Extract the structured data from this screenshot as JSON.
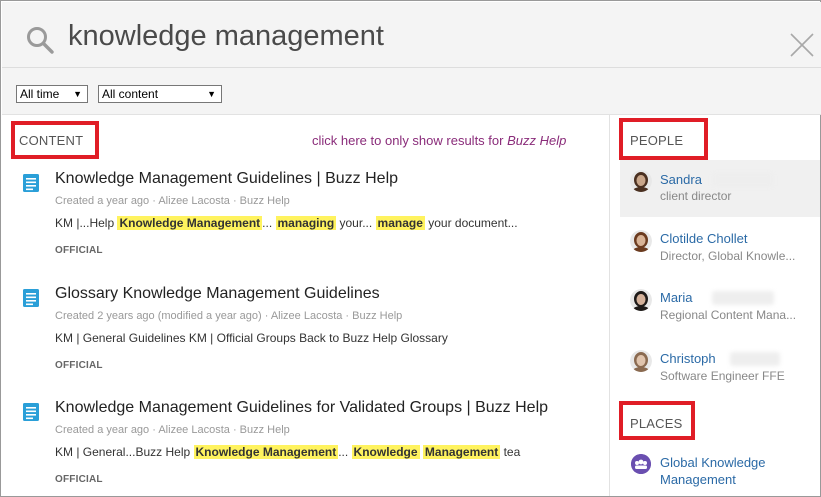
{
  "search": {
    "query": "knowledge management"
  },
  "filters": {
    "time": "All time",
    "content": "All content"
  },
  "content_section": {
    "label": "CONTENT",
    "buzz_link_prefix": "click here to only show results for ",
    "buzz_link_place": "Buzz Help"
  },
  "results": [
    {
      "title": "Knowledge Management Guidelines | Buzz Help",
      "meta": "Created a year ago · Alizee Lacosta · Buzz Help",
      "snippet_parts": [
        {
          "t": "KM |...Help ",
          "hl": false
        },
        {
          "t": "Knowledge Management",
          "hl": true
        },
        {
          "t": "... ",
          "hl": false
        },
        {
          "t": "managing",
          "hl": true
        },
        {
          "t": " your... ",
          "hl": false
        },
        {
          "t": "manage",
          "hl": true
        },
        {
          "t": " your document...",
          "hl": false
        }
      ],
      "badge": "OFFICIAL"
    },
    {
      "title": "Glossary Knowledge Management Guidelines",
      "meta": "Created 2 years ago (modified a year ago) · Alizee Lacosta · Buzz Help",
      "snippet_parts": [
        {
          "t": "KM | General Guidelines KM | Official Groups Back to Buzz Help Glossary",
          "hl": false
        }
      ],
      "badge": "OFFICIAL"
    },
    {
      "title": "Knowledge Management Guidelines for Validated Groups | Buzz Help",
      "meta": "Created a year ago · Alizee Lacosta · Buzz Help",
      "snippet_parts": [
        {
          "t": "KM | General...Buzz Help ",
          "hl": false
        },
        {
          "t": "Knowledge Management",
          "hl": true
        },
        {
          "t": "... ",
          "hl": false
        },
        {
          "t": "Knowledge",
          "hl": true
        },
        {
          "t": " ",
          "hl": false
        },
        {
          "t": "Management",
          "hl": true
        },
        {
          "t": " tea",
          "hl": false
        }
      ],
      "badge": "OFFICIAL"
    }
  ],
  "people_section": {
    "label": "PEOPLE",
    "people": [
      {
        "name": "Sandra",
        "role": "client director",
        "avatar": "woman-dark-hair"
      },
      {
        "name": "Clotilde Chollet",
        "role": "Director, Global Knowle...",
        "avatar": "woman-brown-hair"
      },
      {
        "name": "Maria",
        "role": "Regional Content Mana...",
        "avatar": "woman-black-hair"
      },
      {
        "name": "Christoph",
        "role": "Software Engineer FFE",
        "avatar": "man-light"
      }
    ]
  },
  "places_section": {
    "label": "PLACES",
    "places": [
      {
        "name": "Global Knowledge Management",
        "icon": "group-icon"
      }
    ]
  },
  "colors": {
    "highlight": "#fff35e",
    "link": "#2b6aa6",
    "annotation_red": "#e01d26",
    "buzz_link": "#8a2c7a",
    "place_icon": "#6a4fb0"
  }
}
